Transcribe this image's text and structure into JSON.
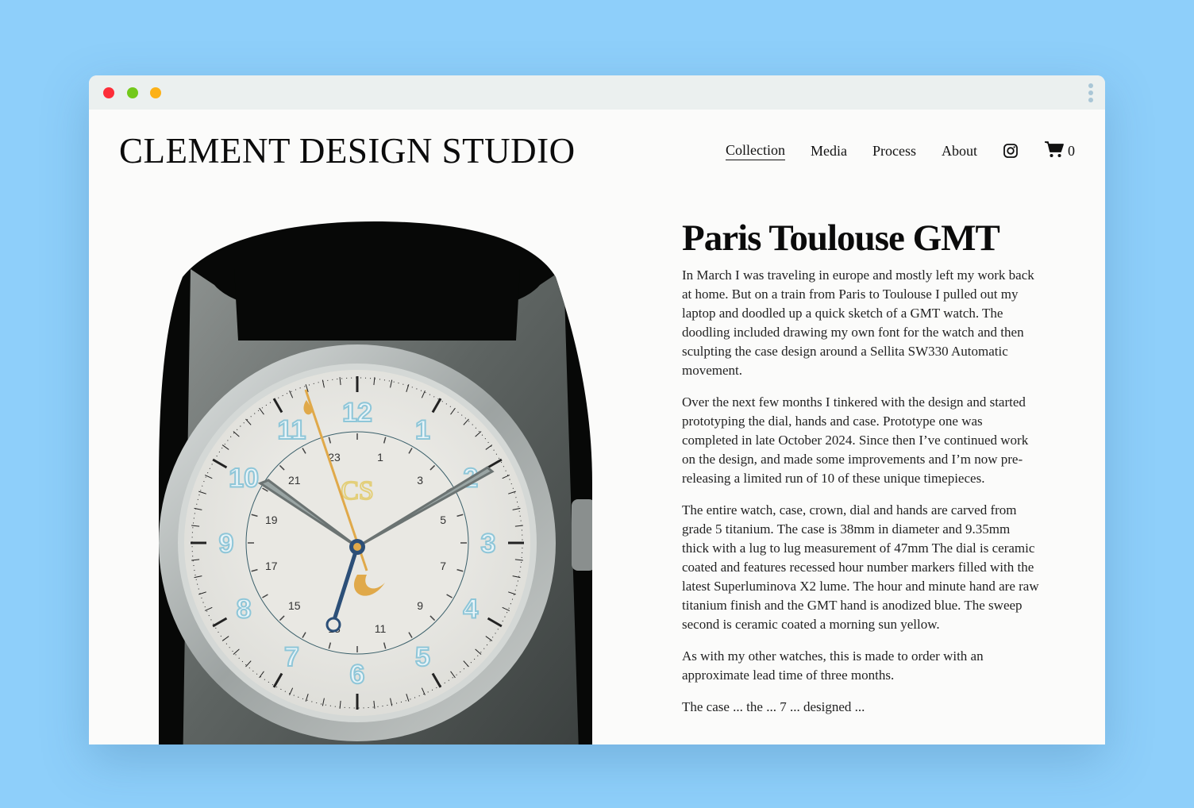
{
  "brand": {
    "logo": "CLEMENT DESIGN STUDIO"
  },
  "nav": {
    "items": [
      {
        "label": "Collection",
        "active": true
      },
      {
        "label": "Media",
        "active": false
      },
      {
        "label": "Process",
        "active": false
      },
      {
        "label": "About",
        "active": false
      }
    ],
    "instagram_icon": "instagram-icon",
    "cart_icon": "cart-icon",
    "cart_count": "0"
  },
  "product": {
    "title": "Paris Toulouse GMT",
    "paragraphs": [
      "In March I was traveling in europe and mostly left my work back at home. But on a train from Paris to Toulouse I pulled out my laptop and doodled up a quick sketch of a GMT watch. The doodling included drawing my own font for the watch and then sculpting the case design around a Sellita SW330 Automatic movement.",
      "Over the next few months I tinkered with the design and started prototyping the dial, hands and case. Prototype one was completed in late October 2024. Since then I’ve continued work on the design, and made some improvements and I’m now pre-releasing a limited run of 10 of these unique timepieces.",
      "The entire watch, case, crown, dial and hands are carved from grade 5 titanium. The case is 38mm in diameter and 9.35mm thick with a lug to lug measurement of 47mm The dial is ceramic coated and features recessed hour number markers filled with the latest Superluminova X2 lume. The hour and minute hand are raw titanium finish and the GMT hand is anodized blue. The sweep second is ceramic coated a morning sun yellow.",
      "As with my other watches, this is made to order with an approximate lead time of three months.",
      "The case ... the ... 7 ... designed ..."
    ],
    "dial_numerals": [
      "12",
      "1",
      "2",
      "3",
      "4",
      "5",
      "6",
      "7",
      "8",
      "9",
      "10",
      "11"
    ],
    "gmt_numerals": [
      "1",
      "3",
      "5",
      "7",
      "9",
      "11",
      "13",
      "15",
      "17",
      "19",
      "21",
      "23"
    ],
    "dial_logo": "CS"
  },
  "colors": {
    "background": "#8ecffa",
    "window": "#fbfbfa",
    "titlebar": "#ebf0ef",
    "lume": "#8ec6d8",
    "second_hand": "#e0a94a",
    "gmt_hand": "#2c4f78"
  }
}
